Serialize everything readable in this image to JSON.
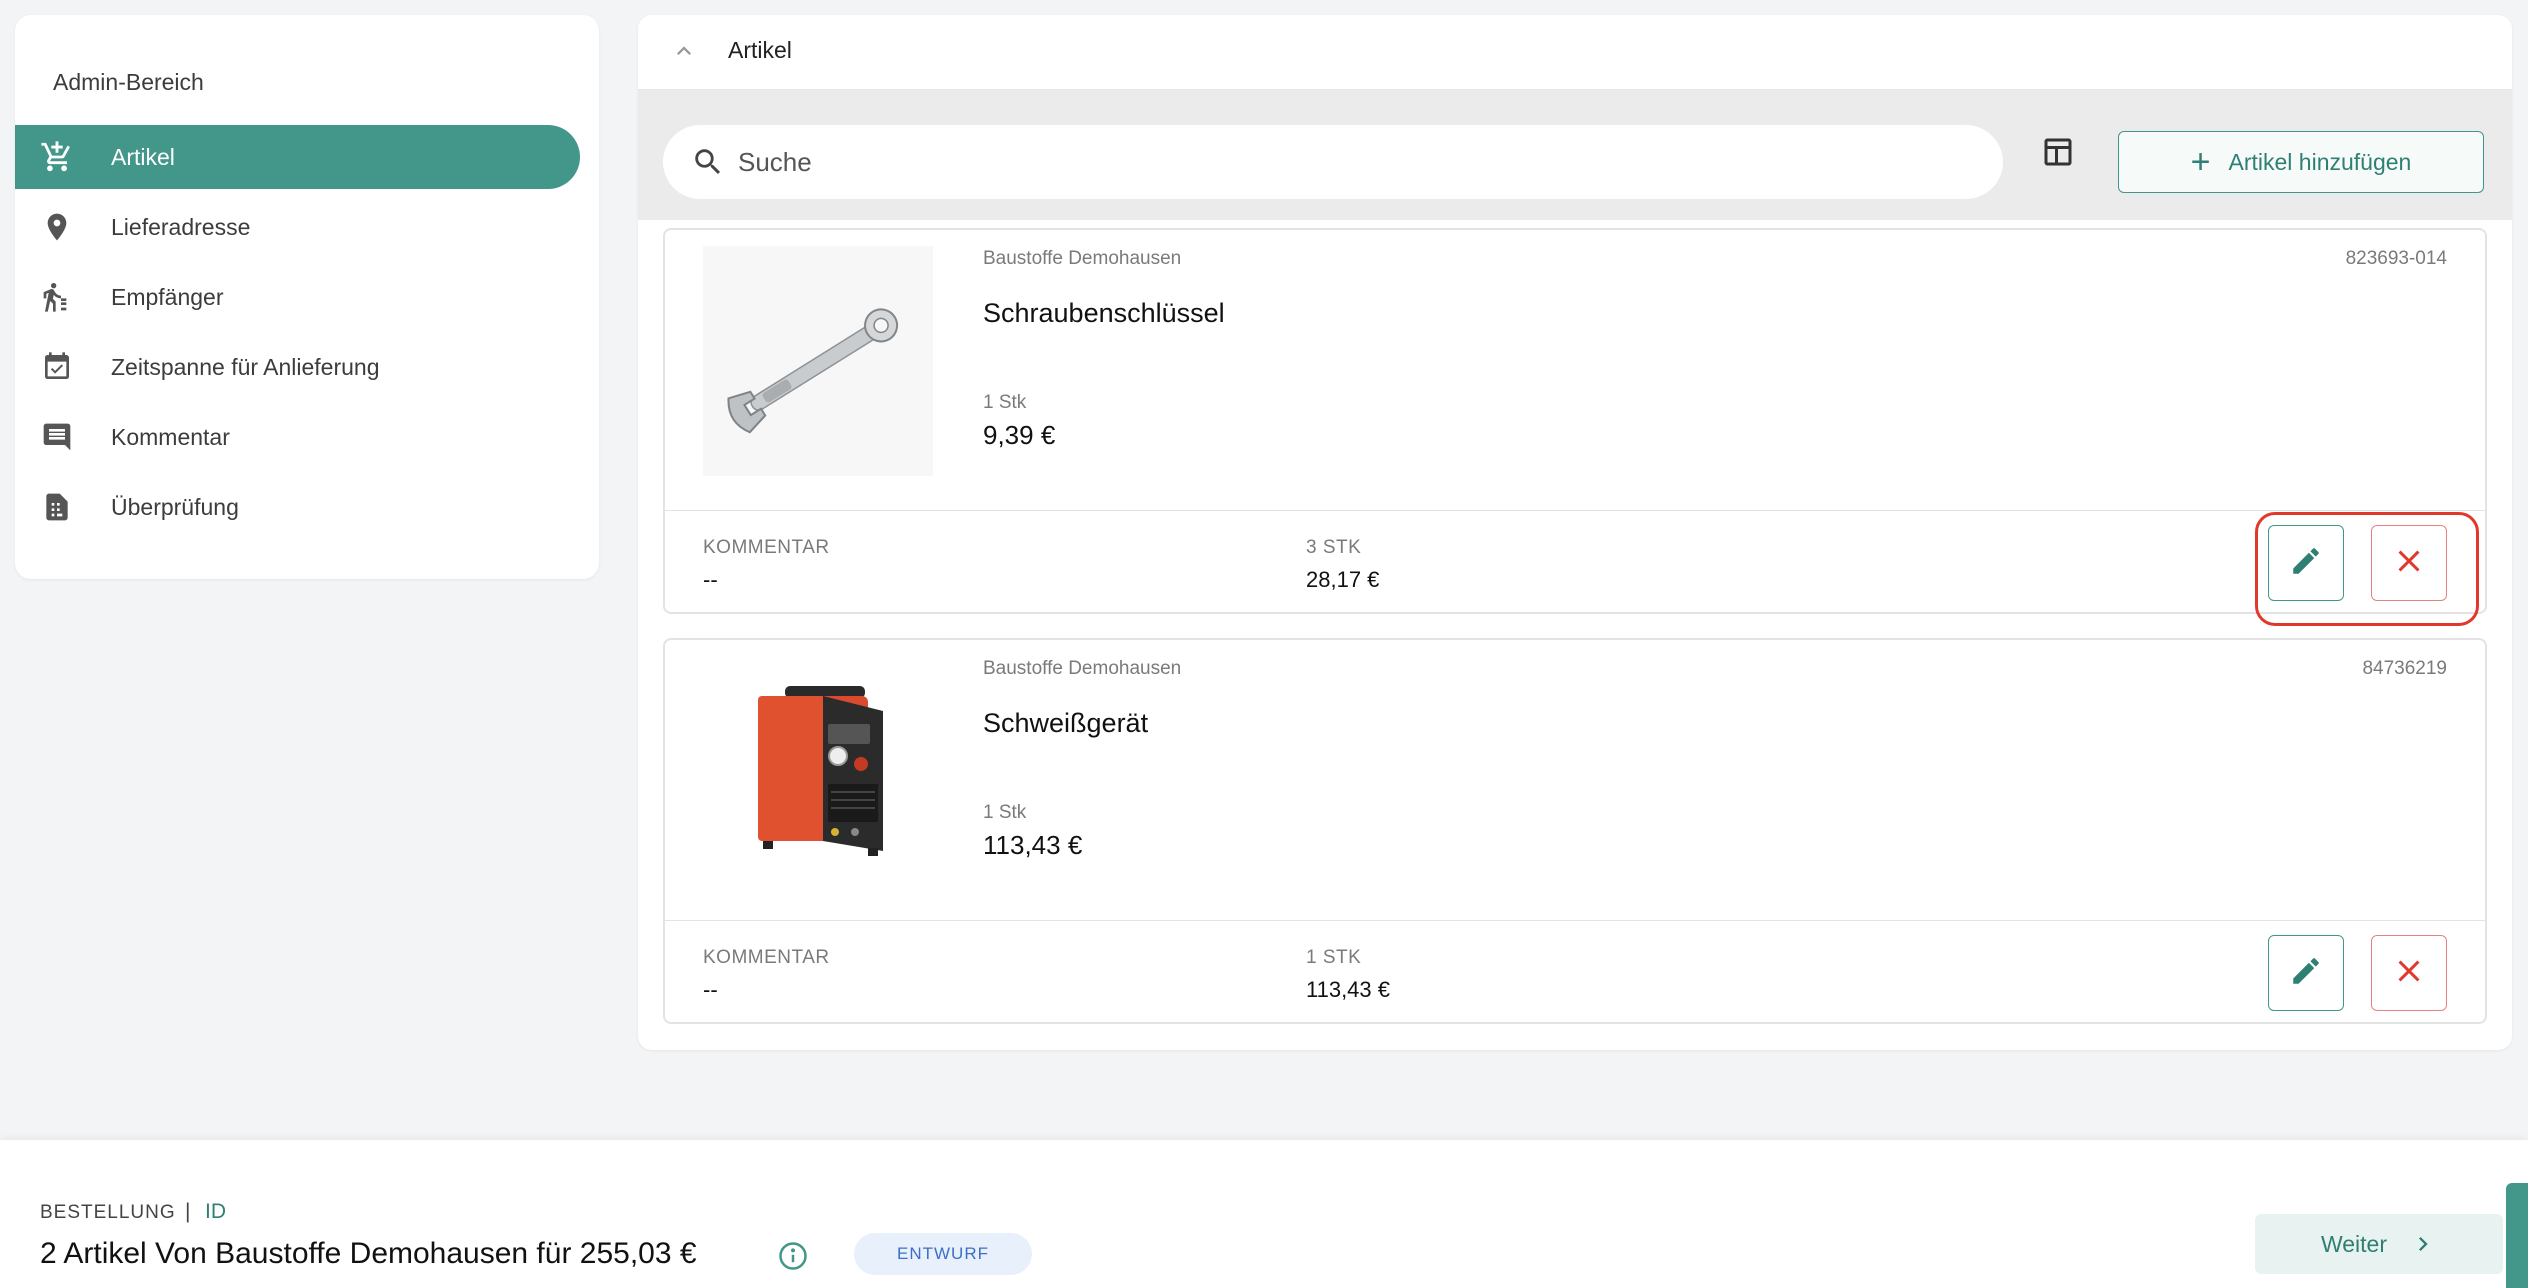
{
  "sidebar": {
    "title": "Admin-Bereich",
    "items": [
      {
        "label": "Artikel",
        "icon": "cart-add-icon",
        "active": true
      },
      {
        "label": "Lieferadresse",
        "icon": "location-pin-icon",
        "active": false
      },
      {
        "label": "Empfänger",
        "icon": "person-walking-icon",
        "active": false
      },
      {
        "label": "Zeitspanne für Anlieferung",
        "icon": "calendar-check-icon",
        "active": false
      },
      {
        "label": "Kommentar",
        "icon": "comment-icon",
        "active": false
      },
      {
        "label": "Überprüfung",
        "icon": "document-review-icon",
        "active": false
      }
    ]
  },
  "main": {
    "title": "Artikel",
    "search": {
      "placeholder": "Suche",
      "value": ""
    },
    "add_button_label": "Artikel hinzufügen",
    "items": [
      {
        "supplier": "Baustoffe Demohausen",
        "article_number": "823693-014",
        "name": "Schraubenschlüssel",
        "unit_qty": "1 Stk",
        "unit_price": "9,39 €",
        "comment_label": "KOMMENTAR",
        "comment_value": "--",
        "total_qty": "3 STK",
        "total_price": "28,17 €",
        "image": "wrench-image"
      },
      {
        "supplier": "Baustoffe Demohausen",
        "article_number": "84736219",
        "name": "Schweißgerät",
        "unit_qty": "1 Stk",
        "unit_price": "113,43 €",
        "comment_label": "KOMMENTAR",
        "comment_value": "--",
        "total_qty": "1 STK",
        "total_price": "113,43 €",
        "image": "welder-image"
      }
    ]
  },
  "footer": {
    "order_label": "BESTELLUNG",
    "separator": "|",
    "id_label": "ID",
    "summary": "2 Artikel Von Baustoffe Demohausen für 255,03 €",
    "status": "ENTWURF",
    "next_label": "Weiter"
  },
  "colors": {
    "accent": "#42968a",
    "danger": "#e0392b",
    "badge_bg": "#e8f0fb",
    "badge_text": "#3b6fc8"
  }
}
